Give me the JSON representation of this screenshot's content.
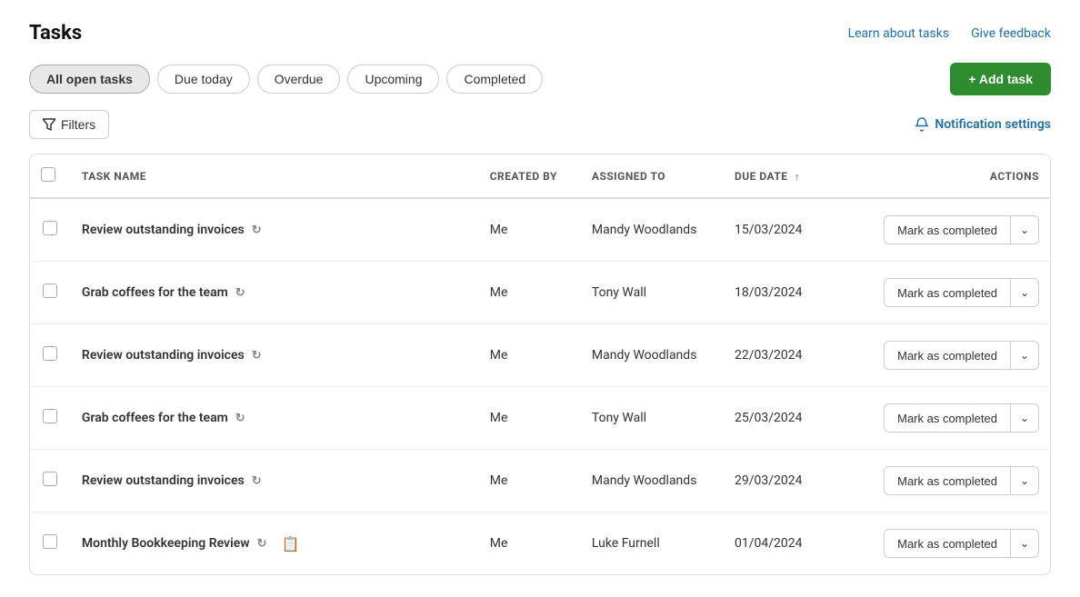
{
  "page": {
    "title": "Tasks",
    "header_links": [
      {
        "id": "learn",
        "label": "Learn about tasks"
      },
      {
        "id": "feedback",
        "label": "Give feedback"
      }
    ]
  },
  "tabs": [
    {
      "id": "all-open",
      "label": "All open tasks",
      "active": true
    },
    {
      "id": "due-today",
      "label": "Due today",
      "active": false
    },
    {
      "id": "overdue",
      "label": "Overdue",
      "active": false
    },
    {
      "id": "upcoming",
      "label": "Upcoming",
      "active": false
    },
    {
      "id": "completed",
      "label": "Completed",
      "active": false
    }
  ],
  "add_task_btn": "+ Add task",
  "filters_btn": "Filters",
  "notification_settings": "Notification settings",
  "table": {
    "columns": [
      {
        "id": "task-name",
        "label": "TASK NAME"
      },
      {
        "id": "created-by",
        "label": "CREATED BY"
      },
      {
        "id": "assigned-to",
        "label": "ASSIGNED TO"
      },
      {
        "id": "due-date",
        "label": "DUE DATE",
        "sortable": true,
        "sort_arrow": "↑"
      },
      {
        "id": "actions",
        "label": "ACTIONS"
      }
    ],
    "rows": [
      {
        "id": 1,
        "task_name": "Review outstanding invoices",
        "has_repeat": true,
        "has_note": false,
        "created_by": "Me",
        "assigned_to": "Mandy Woodlands",
        "due_date": "15/03/2024",
        "action_label": "Mark as completed"
      },
      {
        "id": 2,
        "task_name": "Grab coffees for the team",
        "has_repeat": true,
        "has_note": false,
        "created_by": "Me",
        "assigned_to": "Tony Wall",
        "due_date": "18/03/2024",
        "action_label": "Mark as completed"
      },
      {
        "id": 3,
        "task_name": "Review outstanding invoices",
        "has_repeat": true,
        "has_note": false,
        "created_by": "Me",
        "assigned_to": "Mandy Woodlands",
        "due_date": "22/03/2024",
        "action_label": "Mark as completed"
      },
      {
        "id": 4,
        "task_name": "Grab coffees for the team",
        "has_repeat": true,
        "has_note": false,
        "created_by": "Me",
        "assigned_to": "Tony Wall",
        "due_date": "25/03/2024",
        "action_label": "Mark as completed"
      },
      {
        "id": 5,
        "task_name": "Review outstanding invoices",
        "has_repeat": true,
        "has_note": false,
        "created_by": "Me",
        "assigned_to": "Mandy Woodlands",
        "due_date": "29/03/2024",
        "action_label": "Mark as completed"
      },
      {
        "id": 6,
        "task_name": "Monthly Bookkeeping Review",
        "has_repeat": true,
        "has_note": true,
        "created_by": "Me",
        "assigned_to": "Luke Furnell",
        "due_date": "01/04/2024",
        "action_label": "Mark as completed"
      }
    ]
  }
}
